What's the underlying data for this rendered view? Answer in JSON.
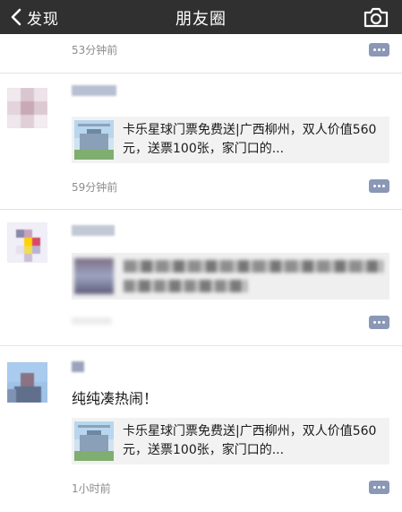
{
  "nav": {
    "back_label": "发现",
    "title": "朋友圈"
  },
  "posts": [
    {
      "time": "53分钟前"
    },
    {
      "time": "59分钟前",
      "link": {
        "title": "卡乐星球门票免费送|广西柳州，双人价值560元，送票100张，家门口的..."
      }
    },
    {
      "time": ""
    },
    {
      "text": "纯纯凑热闹！",
      "time": "1小时前",
      "link": {
        "title": "卡乐星球门票免费送|广西柳州，双人价值560元，送票100张，家门口的..."
      }
    }
  ],
  "colors": {
    "navbar": "#303030",
    "comment_button": "#8a97b6",
    "card_background": "#f2f2f2",
    "timestamp": "#8c8c8c"
  }
}
